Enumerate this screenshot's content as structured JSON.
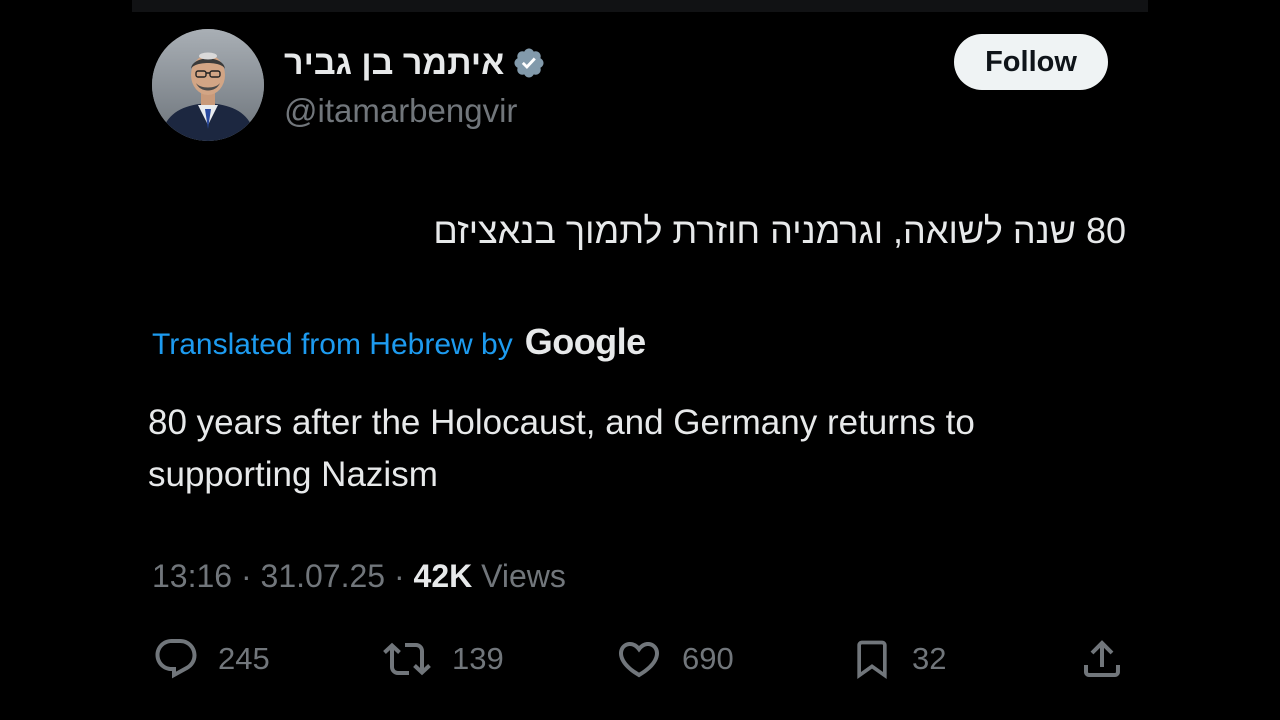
{
  "author": {
    "display_name": "איתמר בן גביר",
    "handle": "@itamarbengvir",
    "verified_icon": "verified-badge-icon",
    "avatar_icon": "profile-photo"
  },
  "follow_label": "Follow",
  "tweet": {
    "original_text": "80 שנה לשואה, וגרמניה חוזרת לתמוך בנאציזם",
    "translated_label": "Translated from Hebrew by",
    "translator_logo": "Google",
    "translated_text": "80 years after the Holocaust, and Germany returns to supporting Nazism"
  },
  "meta": {
    "time": "13:16",
    "separator": "·",
    "date": "31.07.25",
    "views_count": "42K",
    "views_label": "Views"
  },
  "actions": {
    "replies": "245",
    "reposts": "139",
    "likes": "690",
    "bookmarks": "32"
  },
  "colors": {
    "background": "#000000",
    "text_primary": "#e7e9ea",
    "text_secondary": "#71767b",
    "link_blue": "#1d9bf0",
    "follow_bg": "#eff3f4"
  }
}
